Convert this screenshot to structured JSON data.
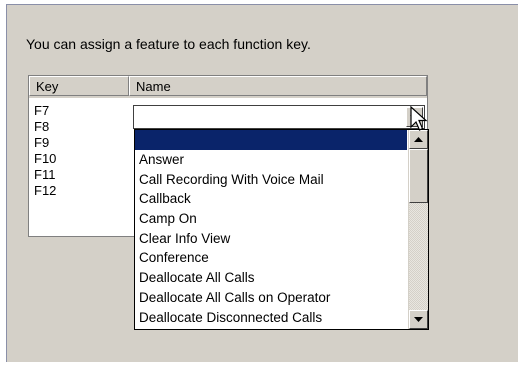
{
  "instruction": "You can assign a feature to each function key.",
  "table": {
    "columns": [
      "Key",
      "Name"
    ],
    "keys": [
      "F7",
      "F8",
      "F9",
      "F10",
      "F11",
      "F12"
    ]
  },
  "combo": {
    "value": "",
    "items": [
      "",
      "Answer",
      "Call Recording With Voice Mail",
      "Callback",
      "Camp On",
      "Clear Info View",
      "Conference",
      "Deallocate All Calls",
      "Deallocate All Calls on Operator",
      "Deallocate Disconnected Calls"
    ],
    "selected_index": 0
  },
  "colors": {
    "panel": "#d4d0c8",
    "selection": "#0a246a"
  },
  "icons": {
    "dropdown_arrow": "triangle-down",
    "scroll_up": "triangle-up",
    "scroll_down": "triangle-down",
    "cursor": "arrow-pointer"
  }
}
